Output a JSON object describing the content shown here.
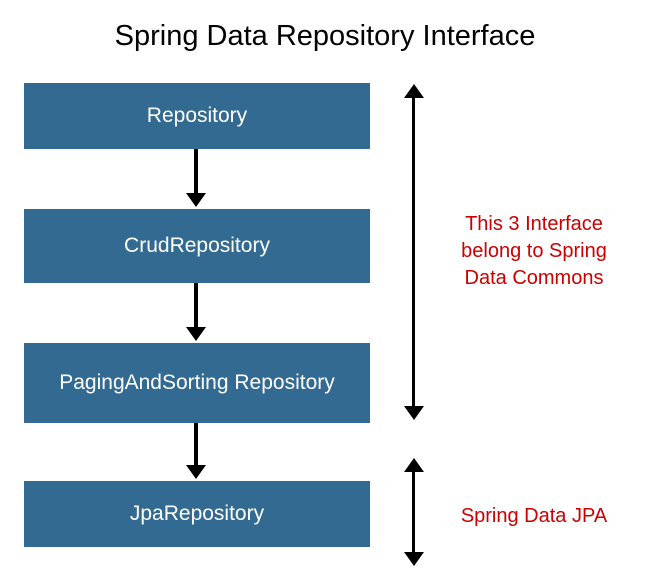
{
  "title": "Spring Data Repository Interface",
  "boxes": {
    "b1": "Repository",
    "b2": "CrudRepository",
    "b3": "PagingAndSorting Repository",
    "b4": "JpaRepository"
  },
  "sideLabels": {
    "commons": "This 3 Interface belong to Spring Data Commons",
    "jpa": "Spring Data JPA"
  },
  "colors": {
    "boxFill": "#336a91",
    "boxText": "#ffffff",
    "sideText": "#cc0000",
    "arrow": "#000000"
  }
}
